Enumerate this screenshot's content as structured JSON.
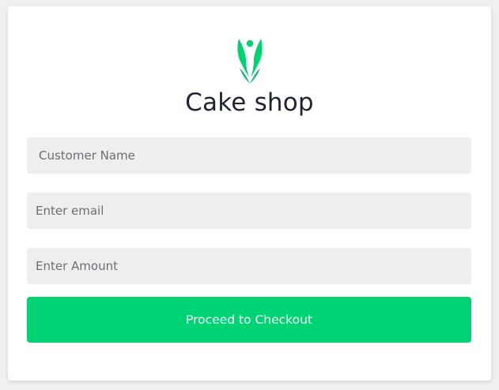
{
  "shop": {
    "logo_icon": "fairy-figure-icon",
    "title": "Cake shop"
  },
  "form": {
    "name_placeholder": "Customer Name",
    "email_placeholder": "Enter email",
    "amount_placeholder": "Enter Amount",
    "submit_label": "Proceed to Checkout"
  },
  "colors": {
    "accent": "#00d374",
    "field_bg": "#eeeeee",
    "title": "#1f2431"
  }
}
